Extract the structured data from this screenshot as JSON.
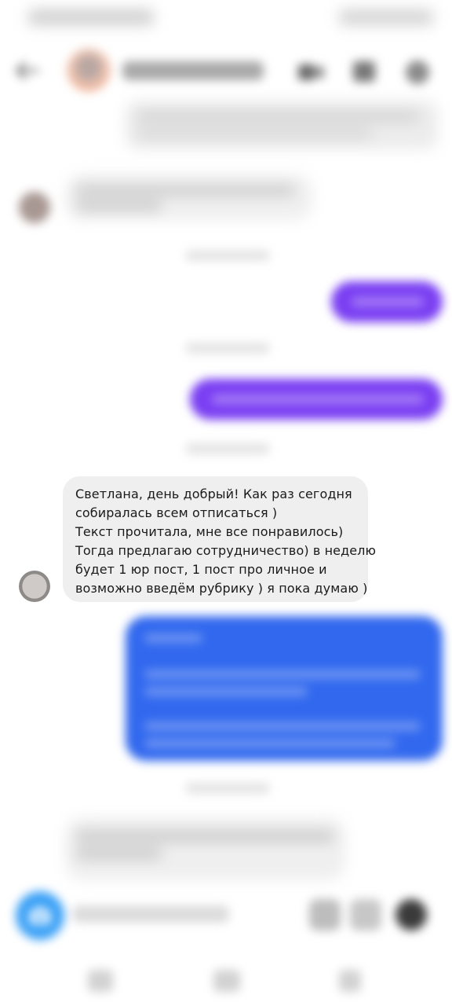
{
  "status_bar": {},
  "header": {
    "contact_name": ""
  },
  "conversation": {
    "main_message": {
      "paragraphs": [
        "Светлана, день добрый! Как раз сегодня",
        "собиралась всем отписаться )",
        "Текст прочитала, мне все понравилось)",
        "Тогда предлагаю сотрудничество) в неделю",
        "будет 1 юр пост, 1 пост про личное и",
        "возможно введём рубрику ) я пока думаю )"
      ]
    }
  },
  "composer": {
    "placeholder": ""
  },
  "colors": {
    "incoming_bubble": "#efefef",
    "outgoing_purple": "#7a3ff2",
    "outgoing_blue": "#3168ee",
    "camera_button": "#3aa0f6"
  },
  "icons": [
    "back-arrow-icon",
    "video-call-icon",
    "flag-icon",
    "info-icon",
    "camera-icon",
    "mic-icon",
    "gallery-icon",
    "sticker-icon"
  ]
}
